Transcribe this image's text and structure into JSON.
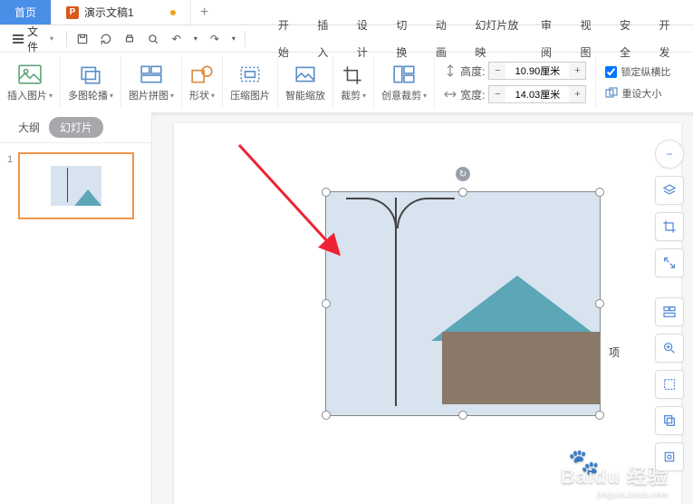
{
  "tabs": {
    "home": "首页",
    "doc": "演示文稿1",
    "doc_icon": "P"
  },
  "menu": {
    "file": "文件"
  },
  "ribbon_tabs": [
    "开始",
    "插入",
    "设计",
    "切换",
    "动画",
    "幻灯片放映",
    "审阅",
    "视图",
    "安全",
    "开发"
  ],
  "groups": {
    "insert_pic": "插入图片",
    "multi_contour": "多图轮播",
    "pic_tile": "图片拼图",
    "shape": "形状",
    "compress": "压缩图片",
    "smart_zoom": "智能缩放",
    "crop": "裁剪",
    "creative_crop": "创意裁剪"
  },
  "size": {
    "height_label": "高度:",
    "width_label": "宽度:",
    "height_val": "10.90厘米",
    "width_val": "14.03厘米"
  },
  "options": {
    "lock_ratio": "锁定纵横比",
    "reset_size": "重设大小"
  },
  "side": {
    "outline": "大纲",
    "slides": "幻灯片",
    "slide1_num": "1"
  },
  "canvas": {
    "ctx_label": "项"
  },
  "watermark": {
    "brand": "Baidu 经验",
    "sub": "jingyan.baidu.com"
  }
}
